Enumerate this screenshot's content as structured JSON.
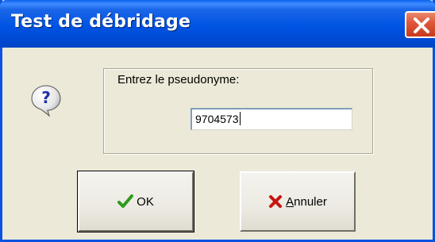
{
  "window": {
    "title": "Test de débridage"
  },
  "dialog": {
    "prompt": "Entrez le pseudonyme:",
    "input_value": "9704573"
  },
  "buttons": {
    "ok_label": "OK",
    "cancel_accel": "A",
    "cancel_rest": "nnuler"
  },
  "icons": {
    "prompt": "question-icon",
    "ok": "checkmark-icon",
    "cancel": "red-x-icon",
    "close": "close-icon"
  },
  "colors": {
    "titlebar": "#0054e3",
    "dialog_bg": "#ece9d8",
    "close_button": "#e0593c",
    "check": "#2e9b1e",
    "cross": "#c8140f"
  }
}
